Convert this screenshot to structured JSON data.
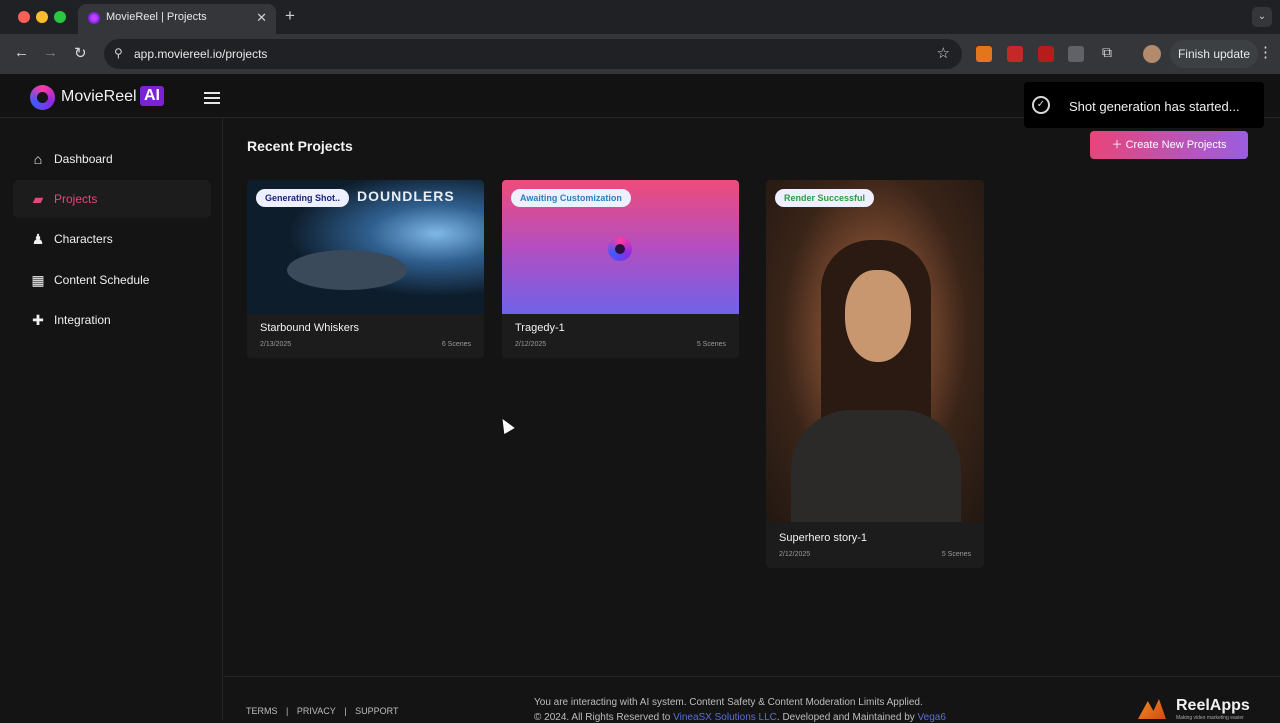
{
  "browser": {
    "tab_title": "MovieReel | Projects",
    "tab_close": "✕",
    "new_tab": "+",
    "tab_menu": "⌄",
    "back": "←",
    "forward": "→",
    "reload": "↻",
    "url": "app.moviereel.io/projects",
    "finish_update": "Finish update",
    "menu": "⋮"
  },
  "app": {
    "logo_text": "MovieReel",
    "logo_ai": "AI"
  },
  "sidebar": {
    "items": [
      {
        "label": "Dashboard",
        "icon": "⌂"
      },
      {
        "label": "Projects",
        "icon": "▰"
      },
      {
        "label": "Characters",
        "icon": "♟"
      },
      {
        "label": "Content Schedule",
        "icon": "▦"
      },
      {
        "label": "Integration",
        "icon": "✚"
      }
    ]
  },
  "main": {
    "title": "Recent Projects",
    "create_button": "＋  Create New Projects"
  },
  "projects": [
    {
      "name": "Starbound Whiskers",
      "date": "2/13/2025",
      "scenes": "6 Scenes",
      "status": "Generating Shot..",
      "status_color": "#1a1f7a",
      "thumb_title": "DOUNDLERS"
    },
    {
      "name": "Tragedy-1",
      "date": "2/12/2025",
      "scenes": "5 Scenes",
      "status": "Awaiting Customization",
      "status_color": "#2a7fbf"
    },
    {
      "name": "Superhero story-1",
      "date": "2/12/2025",
      "scenes": "5 Scenes",
      "status": "Render Successful",
      "status_color": "#2e9d43"
    }
  ],
  "toast": {
    "text": "Shot generation has started..."
  },
  "footer": {
    "terms": "TERMS",
    "privacy": "PRIVACY",
    "support": "SUPPORT",
    "sep": "|",
    "note": "You are interacting with AI system. Content Safety & Content Moderation Limits Applied.",
    "copy_prefix": "© 2024. All Rights Reserved to ",
    "copy_company": "VineaSX Solutions LLC",
    "copy_mid": ". Developed and Maintained by ",
    "copy_dev": "Vega6",
    "brand": "ReelApps",
    "brand_tagline": "Making video marketing easier"
  }
}
